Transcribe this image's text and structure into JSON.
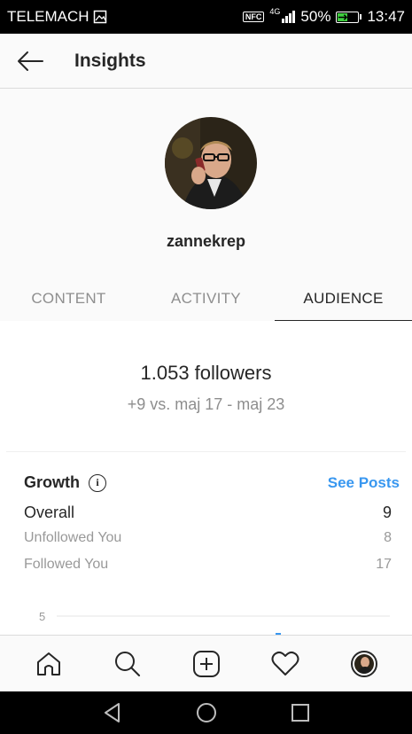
{
  "status_bar": {
    "carrier": "TELEMACH",
    "nfc": "NFC",
    "network": "4G",
    "battery_percent": "50%",
    "battery_level": 0.5,
    "time": "13:47"
  },
  "header": {
    "title": "Insights"
  },
  "profile": {
    "username": "zannekrep"
  },
  "tabs": [
    {
      "label": "CONTENT",
      "active": false
    },
    {
      "label": "ACTIVITY",
      "active": false
    },
    {
      "label": "AUDIENCE",
      "active": true
    }
  ],
  "summary": {
    "followers": "1.053 followers",
    "comparison": "+9 vs. maj 17 - maj 23"
  },
  "growth": {
    "title": "Growth",
    "see_posts": "See Posts",
    "rows": [
      {
        "label": "Overall",
        "value": "9"
      },
      {
        "label": "Unfollowed You",
        "value": "8"
      },
      {
        "label": "Followed You",
        "value": "17"
      }
    ],
    "chart": {
      "y_tick": "5"
    }
  },
  "bottom_nav": [
    {
      "name": "home"
    },
    {
      "name": "search"
    },
    {
      "name": "new-post"
    },
    {
      "name": "activity"
    },
    {
      "name": "profile"
    }
  ],
  "colors": {
    "accent": "#3897f0",
    "text": "#262626",
    "muted": "#8e8e8e"
  }
}
